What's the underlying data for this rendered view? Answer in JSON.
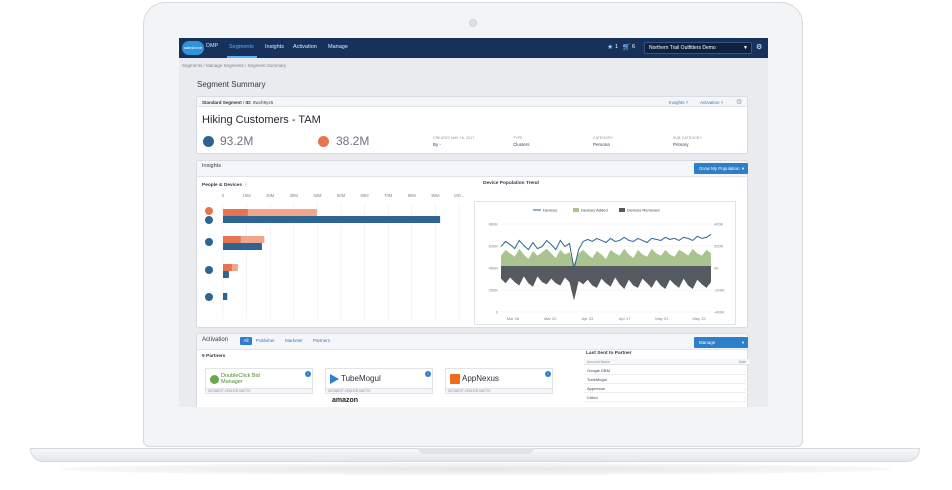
{
  "topnav": {
    "logo_text": "salesforce",
    "app_name": "DMP",
    "items": [
      {
        "label": "Segments",
        "active": true
      },
      {
        "label": "Insights",
        "active": false
      },
      {
        "label": "Activation",
        "active": false
      },
      {
        "label": "Manage",
        "active": false
      }
    ],
    "alerts_count": "1",
    "cart_count": "6",
    "org_select": "Northern Trail Outfitters Demo"
  },
  "breadcrumb": [
    "Segments",
    "Manage Segments",
    "Segment Summary"
  ],
  "page_title": "Segment Summary",
  "segment": {
    "type": "Standard Segment",
    "id_label": "ID:",
    "id": "rtwch9yz6",
    "insights_link": "Insights",
    "activation_link": "Activation",
    "name": "Hiking Customers - TAM",
    "metric1": "93.2M",
    "metric2": "38.2M",
    "meta": [
      {
        "label": "Created May 16, 2017",
        "value": "By -"
      },
      {
        "label": "Type",
        "value": "Clusters"
      },
      {
        "label": "Category",
        "value": "Persona"
      },
      {
        "label": "Sub-Category",
        "value": "Primary"
      }
    ]
  },
  "insights": {
    "title": "Insights",
    "grow_button": "Grow My Population",
    "people_devices_title": "People & Devices",
    "trend_title": "Device Population Trend"
  },
  "chart_data": [
    {
      "type": "bar",
      "title": "People & Devices",
      "x_ticks": [
        "0",
        "10M",
        "20M",
        "30M",
        "40M",
        "50M",
        "60M",
        "70M",
        "80M",
        "90M",
        "100..."
      ],
      "xlim": [
        0,
        100
      ],
      "series": [
        {
          "values": [
            10.5,
            35.5,
            9,
            22,
            1,
            0,
            0,
            0
          ],
          "color": "#e8734f"
        },
        {
          "values": [
            0,
            0,
            0,
            0,
            0,
            0,
            0,
            0
          ],
          "color": "#f2a58d"
        },
        {
          "values": [
            0,
            92,
            0,
            16.5,
            0,
            2.5,
            0,
            1.8
          ],
          "color": "#2d6491"
        }
      ],
      "rows": [
        {
          "people_a": 10.5,
          "people_b": 39.8,
          "devices": 0
        },
        {
          "people_a": 0,
          "people_b": 0,
          "devices": 92
        },
        {
          "people_a": 7.5,
          "people_b": 17.5,
          "devices": 0
        },
        {
          "people_a": 0,
          "people_b": 0,
          "devices": 16.5
        },
        {
          "people_a": 3.8,
          "people_b": 6.3,
          "devices": 0
        },
        {
          "people_a": 0,
          "people_b": 0,
          "devices": 2.5
        },
        {
          "people_a": 0,
          "people_b": 0,
          "devices": 1.8
        }
      ],
      "grid": true
    },
    {
      "type": "line",
      "title": "Device Population Trend",
      "legend": [
        "Devices",
        "Devices Added",
        "Devices Removed"
      ],
      "colors": {
        "devices": "#2d6491",
        "added": "#a9c48f",
        "removed": "#555a60"
      },
      "y_left_ticks": [
        "800K",
        "600K",
        "400K",
        "200K",
        "0"
      ],
      "y_right_ticks": [
        "400K",
        "200K",
        "0K",
        "-200K",
        "-400K"
      ],
      "x_ticks": [
        "Mar 06",
        "Mar 20",
        "Apr 03",
        "Apr 17",
        "May 01",
        "May 15"
      ],
      "ylim": [
        0,
        900000
      ],
      "y2lim": [
        -400000,
        400000
      ],
      "devices": [
        640000,
        690000,
        660000,
        620000,
        700000,
        650000,
        610000,
        680000,
        620000,
        640000,
        700000,
        660000,
        610000,
        700000,
        640000,
        670000,
        420000,
        610000,
        690000,
        710000,
        690000,
        720000,
        700000,
        680000,
        720000,
        690000,
        700000,
        730000,
        700000,
        690000,
        720000,
        700000,
        680000,
        720000,
        710000,
        700000,
        730000,
        710000,
        720000,
        700000,
        730000,
        720000,
        700000,
        740000,
        720000,
        730000,
        760000
      ],
      "added": [
        90000,
        140000,
        110000,
        80000,
        150000,
        100000,
        60000,
        130000,
        90000,
        120000,
        150000,
        110000,
        70000,
        140000,
        100000,
        120000,
        20000,
        110000,
        140000,
        100000,
        70000,
        130000,
        100000,
        60000,
        140000,
        110000,
        90000,
        150000,
        100000,
        70000,
        140000,
        100000,
        80000,
        150000,
        110000,
        90000,
        140000,
        100000,
        80000,
        140000,
        120000,
        90000,
        150000,
        110000,
        90000,
        140000,
        110000
      ],
      "removed": [
        -110000,
        -150000,
        -100000,
        -140000,
        -170000,
        -90000,
        -150000,
        -180000,
        -90000,
        -140000,
        -160000,
        -110000,
        -150000,
        -170000,
        -100000,
        -140000,
        -300000,
        -130000,
        -160000,
        -120000,
        -170000,
        -190000,
        -110000,
        -150000,
        -180000,
        -100000,
        -160000,
        -200000,
        -120000,
        -170000,
        -190000,
        -110000,
        -150000,
        -190000,
        -120000,
        -170000,
        -200000,
        -120000,
        -160000,
        -190000,
        -110000,
        -170000,
        -200000,
        -120000,
        -160000,
        -190000,
        -140000
      ]
    }
  ],
  "activation": {
    "title": "Activation",
    "tabs": [
      "All",
      "Publisher",
      "Marketer",
      "Partners"
    ],
    "manage_button": "Manage",
    "partners_count_label": "5 Partners",
    "partners": [
      {
        "name": "DoubleClick Bid Manager",
        "match": "SEGMENT-VENDOR-MATCH"
      },
      {
        "name": "TubeMogul",
        "match": "SEGMENT-VENDOR-MATCH"
      },
      {
        "name": "AppNexus",
        "match": "SEGMENT-VENDOR-MATCH"
      }
    ],
    "partial_partner": "amazon",
    "last_sent_title": "Last Sent to Partner",
    "last_sent_headers": [
      "Account Name",
      "Date"
    ],
    "last_sent_rows": [
      "Google DBM",
      "TubeMogul",
      "Appnexus",
      "Criteo"
    ]
  }
}
